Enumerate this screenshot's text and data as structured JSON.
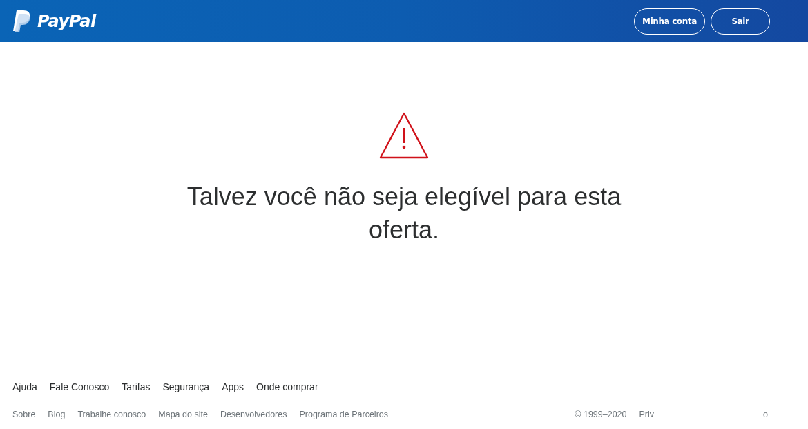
{
  "header": {
    "logo": "PayPal",
    "buttons": [
      "Minha conta",
      "Sair"
    ]
  },
  "message": "Talvez você não seja elegível para esta oferta.",
  "footer": {
    "main_links": [
      "Ajuda",
      "Fale Conosco",
      "Tarifas",
      "Segurança",
      "Apps",
      "Onde comprar"
    ],
    "secondary_links": [
      "Sobre",
      "Blog",
      "Trabalhe conosco",
      "Mapa do site",
      "Desenvolvedores",
      "Programa de Parceiros"
    ],
    "copyright": "© 1999–2020",
    "legal_links": [
      "Priv",
      "o"
    ]
  }
}
